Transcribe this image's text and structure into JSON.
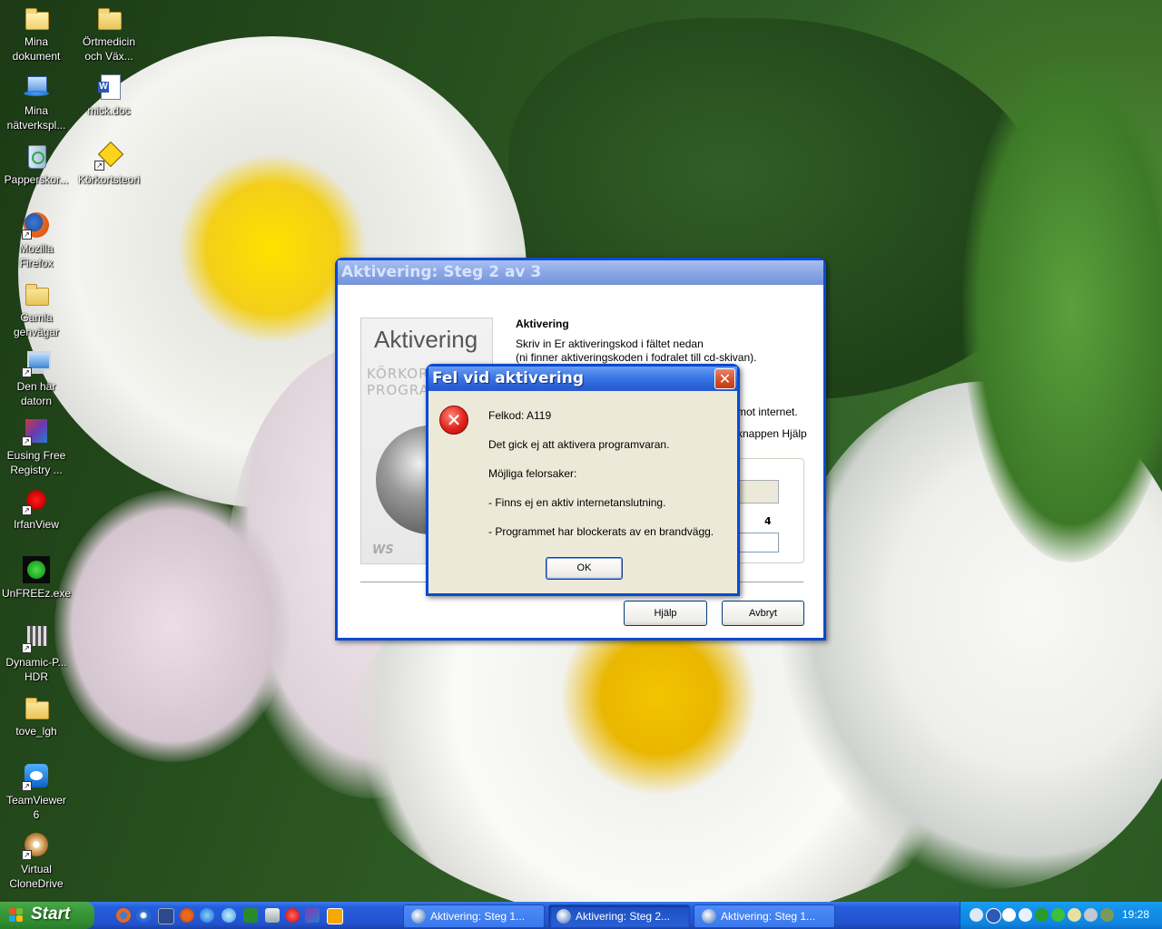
{
  "desktop": {
    "icons": [
      {
        "label": "Mina\ndokument",
        "icon": "my-documents-icon"
      },
      {
        "label": "Örtmedicin\noch Väx...",
        "icon": "folder-icon"
      },
      {
        "label": "Mina\nnätverkspl...",
        "icon": "network-places-icon"
      },
      {
        "label": "mick.doc",
        "icon": "word-document-icon"
      },
      {
        "label": "Papperskor...",
        "icon": "recycle-bin-icon"
      },
      {
        "label": "Körkortsteori",
        "icon": "shortcut-diamond-icon"
      },
      {
        "label": "Mozilla\nFirefox",
        "icon": "firefox-icon"
      },
      {
        "label": "Gamla\ngenvägar",
        "icon": "folder-icon"
      },
      {
        "label": "Den här\ndatorn",
        "icon": "my-computer-icon"
      },
      {
        "label": "Eusing Free\nRegistry ...",
        "icon": "registry-cleaner-icon"
      },
      {
        "label": "IrfanView",
        "icon": "irfanview-icon"
      },
      {
        "label": "UnFREEz.exe",
        "icon": "unfreez-icon"
      },
      {
        "label": "Dynamic-P...\nHDR",
        "icon": "hdr-icon"
      },
      {
        "label": "tove_lgh",
        "icon": "folder-icon"
      },
      {
        "label": "TeamViewer\n6",
        "icon": "teamviewer-icon"
      },
      {
        "label": "Virtual\nCloneDrive",
        "icon": "virtual-clonedrive-icon"
      }
    ]
  },
  "main_window": {
    "title": "Aktivering: Steg 2 av 3",
    "banner_title": "Aktivering",
    "banner_subtitle": "KÖRKORTSTEORI PROGRAM",
    "banner_logo": "WS",
    "heading": "Aktivering",
    "instruction_line1": "Skriv in Er aktiveringskod i fältet nedan",
    "instruction_line2": "(ni finner aktiveringskoden i fodralet till cd-skivan).",
    "partial_line1": "mot internet.",
    "partial_line2": "knappen Hjälp",
    "field_number": "4",
    "help_button": "Hjälp",
    "cancel_button": "Avbryt"
  },
  "error_dialog": {
    "title": "Fel vid aktivering",
    "error_code": "Felkod: A119",
    "message": "Det gick ej att aktivera programvaran.",
    "causes_heading": "Möjliga felorsaker:",
    "cause1": "- Finns ej en aktiv internetanslutning.",
    "cause2": "- Programmet har blockerats av en brandvägg.",
    "ok_button": "OK",
    "icon": "error-x-icon",
    "close_icon": "close-icon"
  },
  "taskbar": {
    "start_label": "Start",
    "tasks": [
      {
        "label": "Aktivering: Steg 1...",
        "active": false
      },
      {
        "label": "Aktivering: Steg 2...",
        "active": true
      },
      {
        "label": "Aktivering: Steg 1...",
        "active": false
      }
    ],
    "clock": "19:28"
  }
}
